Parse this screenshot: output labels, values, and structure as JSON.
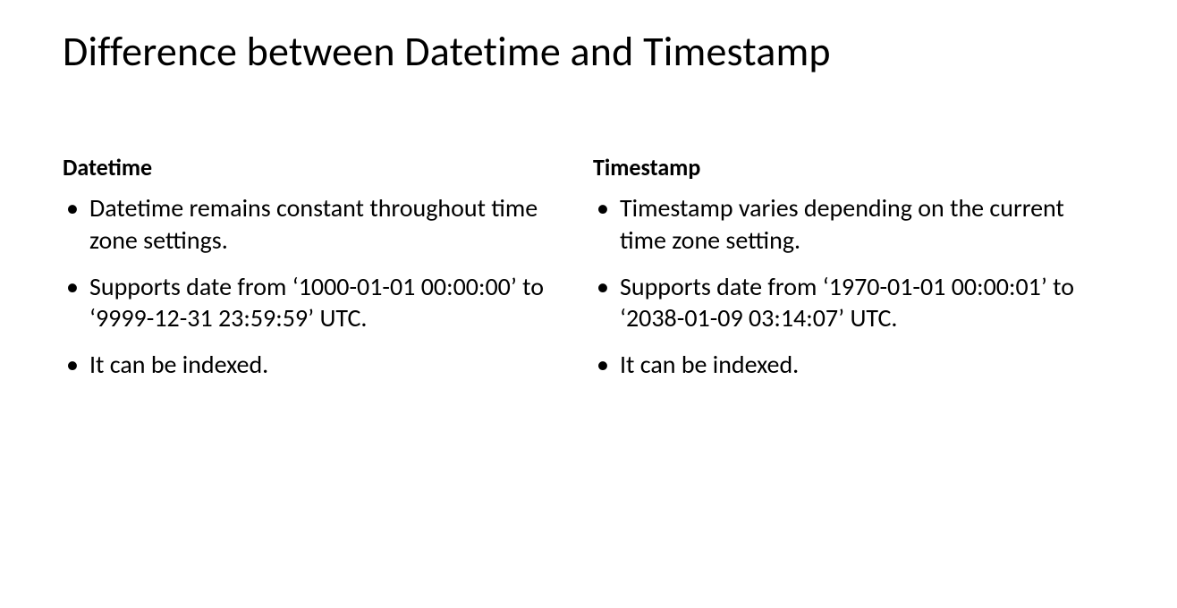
{
  "title": "Difference between Datetime and Timestamp",
  "columns": {
    "left": {
      "heading": "Datetime",
      "items": [
        "Datetime remains constant throughout time zone settings.",
        "Supports date from ‘1000-01-01 00:00:00’ to ‘9999-12-31 23:59:59’ UTC.",
        "It can be indexed."
      ]
    },
    "right": {
      "heading": "Timestamp",
      "items": [
        "Timestamp varies depending on the current time zone setting.",
        "Supports date from ‘1970-01-01 00:00:01’ to ‘2038-01-09 03:14:07’ UTC.",
        "It can be indexed."
      ]
    }
  }
}
